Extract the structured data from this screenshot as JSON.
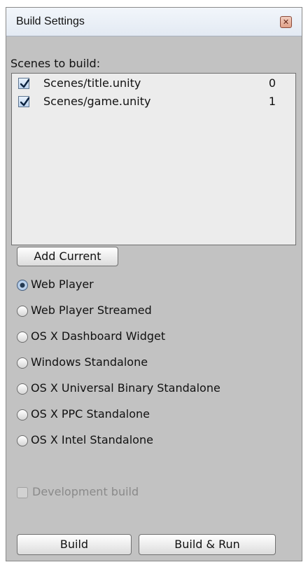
{
  "window": {
    "title": "Build Settings",
    "close_glyph": "✕"
  },
  "scenes": {
    "label": "Scenes to build:",
    "items": [
      {
        "name": "Scenes/title.unity",
        "index": "0",
        "checked": true
      },
      {
        "name": "Scenes/game.unity",
        "index": "1",
        "checked": true
      }
    ]
  },
  "add_current_label": "Add Current",
  "platforms": [
    {
      "label": "Web Player",
      "selected": true
    },
    {
      "label": "Web Player Streamed",
      "selected": false
    },
    {
      "label": "OS X Dashboard Widget",
      "selected": false
    },
    {
      "label": "Windows Standalone",
      "selected": false
    },
    {
      "label": "OS X Universal Binary Standalone",
      "selected": false
    },
    {
      "label": "OS X PPC Standalone",
      "selected": false
    },
    {
      "label": "OS X Intel Standalone",
      "selected": false
    }
  ],
  "development_build": {
    "label": "Development build",
    "checked": false,
    "enabled": false
  },
  "buttons": {
    "build": "Build",
    "build_and_run": "Build & Run"
  }
}
